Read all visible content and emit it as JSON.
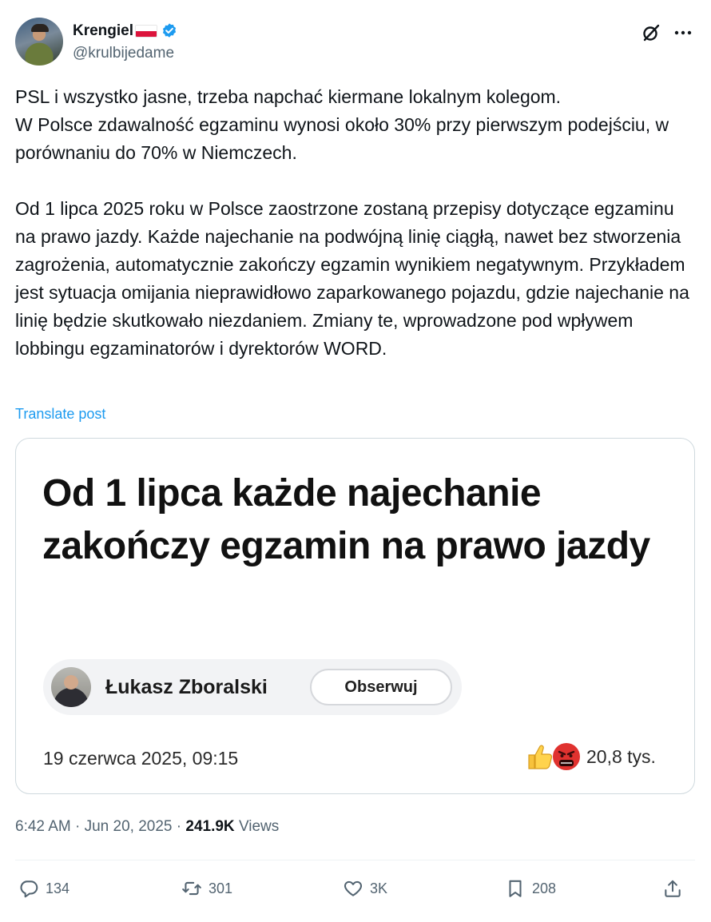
{
  "author": {
    "display_name": "Krengiel",
    "flag_icon": "poland-flag-icon",
    "verified_icon": "verified-badge-icon",
    "handle": "@krulbijedame"
  },
  "tweet": {
    "text": "PSL i wszystko jasne, trzeba napchać kiermane lokalnym kolegom.\nW Polsce zdawalność egzaminu wynosi około 30% przy pierwszym podejściu, w porównaniu do 70% w Niemczech.\n\nOd 1 lipca 2025 roku w Polsce zaostrzone zostaną przepisy dotyczące egzaminu na prawo jazdy. Każde najechanie na podwójną linię ciągłą, nawet bez stworzenia zagrożenia, automatycznie zakończy egzamin wynikiem negatywnym. Przykładem jest sytuacja omijania nieprawidłowo zaparkowanego pojazdu, gdzie najechanie na linię będzie skutkowało niezdaniem. Zmiany te, wprowadzone pod wpływem lobbingu egzaminatorów i dyrektorów WORD.",
    "translate_label": "Translate post"
  },
  "card": {
    "headline": "Od 1 lipca każde najechanie zakończy egzamin na prawo jazdy",
    "author_name": "Łukasz Zboralski",
    "follow_label": "Obserwuj",
    "date": "19 czerwca 2025, 09:15",
    "reaction_count": "20,8 tys."
  },
  "meta": {
    "time": "6:42 AM",
    "separator": "·",
    "date": "Jun 20, 2025",
    "views_count": "241.9K",
    "views_label": "Views"
  },
  "actions": {
    "replies": "134",
    "reposts": "301",
    "likes": "3K",
    "bookmarks": "208"
  },
  "colors": {
    "accent": "#1d9bf0",
    "secondary_text": "#536471",
    "flag_red": "#dc143c"
  }
}
